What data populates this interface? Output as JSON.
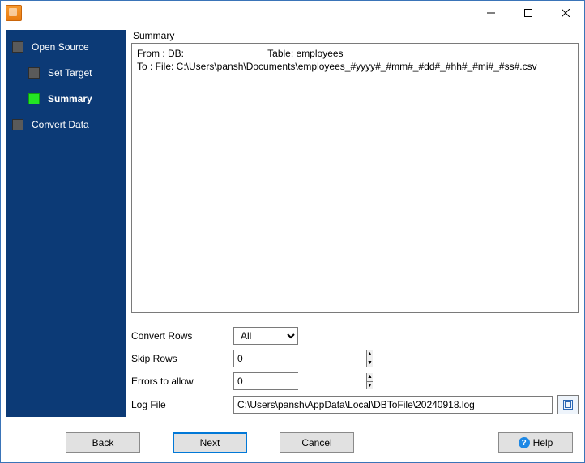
{
  "sidebar": {
    "items": [
      {
        "label": "Open Source"
      },
      {
        "label": "Set Target"
      },
      {
        "label": "Summary"
      },
      {
        "label": "Convert Data"
      }
    ]
  },
  "summary": {
    "title": "Summary",
    "from_prefix": "From : DB:",
    "from_table_label": "Table: ",
    "from_table": "employees",
    "to": "To : File: C:\\Users\\pansh\\Documents\\employees_#yyyy#_#mm#_#dd#_#hh#_#mi#_#ss#.csv"
  },
  "form": {
    "convert_rows_label": "Convert Rows",
    "convert_rows_value": "All",
    "skip_rows_label": "Skip Rows",
    "skip_rows_value": "0",
    "errors_label": "Errors to allow",
    "errors_value": "0",
    "log_label": "Log File",
    "log_value": "C:\\Users\\pansh\\AppData\\Local\\DBToFile\\20240918.log"
  },
  "footer": {
    "back": "Back",
    "next": "Next",
    "cancel": "Cancel",
    "help": "Help"
  }
}
